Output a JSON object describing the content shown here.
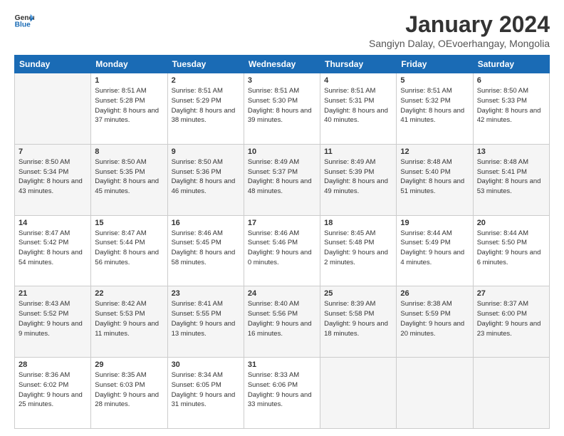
{
  "logo": {
    "line1": "General",
    "line2": "Blue"
  },
  "title": "January 2024",
  "location": "Sangiyn Dalay, OEvoerhangay, Mongolia",
  "days_of_week": [
    "Sunday",
    "Monday",
    "Tuesday",
    "Wednesday",
    "Thursday",
    "Friday",
    "Saturday"
  ],
  "weeks": [
    [
      {
        "day": "",
        "empty": true
      },
      {
        "day": "1",
        "sunrise": "8:51 AM",
        "sunset": "5:28 PM",
        "daylight": "8 hours and 37 minutes."
      },
      {
        "day": "2",
        "sunrise": "8:51 AM",
        "sunset": "5:29 PM",
        "daylight": "8 hours and 38 minutes."
      },
      {
        "day": "3",
        "sunrise": "8:51 AM",
        "sunset": "5:30 PM",
        "daylight": "8 hours and 39 minutes."
      },
      {
        "day": "4",
        "sunrise": "8:51 AM",
        "sunset": "5:31 PM",
        "daylight": "8 hours and 40 minutes."
      },
      {
        "day": "5",
        "sunrise": "8:51 AM",
        "sunset": "5:32 PM",
        "daylight": "8 hours and 41 minutes."
      },
      {
        "day": "6",
        "sunrise": "8:50 AM",
        "sunset": "5:33 PM",
        "daylight": "8 hours and 42 minutes."
      }
    ],
    [
      {
        "day": "7",
        "sunrise": "8:50 AM",
        "sunset": "5:34 PM",
        "daylight": "8 hours and 43 minutes."
      },
      {
        "day": "8",
        "sunrise": "8:50 AM",
        "sunset": "5:35 PM",
        "daylight": "8 hours and 45 minutes."
      },
      {
        "day": "9",
        "sunrise": "8:50 AM",
        "sunset": "5:36 PM",
        "daylight": "8 hours and 46 minutes."
      },
      {
        "day": "10",
        "sunrise": "8:49 AM",
        "sunset": "5:37 PM",
        "daylight": "8 hours and 48 minutes."
      },
      {
        "day": "11",
        "sunrise": "8:49 AM",
        "sunset": "5:39 PM",
        "daylight": "8 hours and 49 minutes."
      },
      {
        "day": "12",
        "sunrise": "8:48 AM",
        "sunset": "5:40 PM",
        "daylight": "8 hours and 51 minutes."
      },
      {
        "day": "13",
        "sunrise": "8:48 AM",
        "sunset": "5:41 PM",
        "daylight": "8 hours and 53 minutes."
      }
    ],
    [
      {
        "day": "14",
        "sunrise": "8:47 AM",
        "sunset": "5:42 PM",
        "daylight": "8 hours and 54 minutes."
      },
      {
        "day": "15",
        "sunrise": "8:47 AM",
        "sunset": "5:44 PM",
        "daylight": "8 hours and 56 minutes."
      },
      {
        "day": "16",
        "sunrise": "8:46 AM",
        "sunset": "5:45 PM",
        "daylight": "8 hours and 58 minutes."
      },
      {
        "day": "17",
        "sunrise": "8:46 AM",
        "sunset": "5:46 PM",
        "daylight": "9 hours and 0 minutes."
      },
      {
        "day": "18",
        "sunrise": "8:45 AM",
        "sunset": "5:48 PM",
        "daylight": "9 hours and 2 minutes."
      },
      {
        "day": "19",
        "sunrise": "8:44 AM",
        "sunset": "5:49 PM",
        "daylight": "9 hours and 4 minutes."
      },
      {
        "day": "20",
        "sunrise": "8:44 AM",
        "sunset": "5:50 PM",
        "daylight": "9 hours and 6 minutes."
      }
    ],
    [
      {
        "day": "21",
        "sunrise": "8:43 AM",
        "sunset": "5:52 PM",
        "daylight": "9 hours and 9 minutes."
      },
      {
        "day": "22",
        "sunrise": "8:42 AM",
        "sunset": "5:53 PM",
        "daylight": "9 hours and 11 minutes."
      },
      {
        "day": "23",
        "sunrise": "8:41 AM",
        "sunset": "5:55 PM",
        "daylight": "9 hours and 13 minutes."
      },
      {
        "day": "24",
        "sunrise": "8:40 AM",
        "sunset": "5:56 PM",
        "daylight": "9 hours and 16 minutes."
      },
      {
        "day": "25",
        "sunrise": "8:39 AM",
        "sunset": "5:58 PM",
        "daylight": "9 hours and 18 minutes."
      },
      {
        "day": "26",
        "sunrise": "8:38 AM",
        "sunset": "5:59 PM",
        "daylight": "9 hours and 20 minutes."
      },
      {
        "day": "27",
        "sunrise": "8:37 AM",
        "sunset": "6:00 PM",
        "daylight": "9 hours and 23 minutes."
      }
    ],
    [
      {
        "day": "28",
        "sunrise": "8:36 AM",
        "sunset": "6:02 PM",
        "daylight": "9 hours and 25 minutes."
      },
      {
        "day": "29",
        "sunrise": "8:35 AM",
        "sunset": "6:03 PM",
        "daylight": "9 hours and 28 minutes."
      },
      {
        "day": "30",
        "sunrise": "8:34 AM",
        "sunset": "6:05 PM",
        "daylight": "9 hours and 31 minutes."
      },
      {
        "day": "31",
        "sunrise": "8:33 AM",
        "sunset": "6:06 PM",
        "daylight": "9 hours and 33 minutes."
      },
      {
        "day": "",
        "empty": true
      },
      {
        "day": "",
        "empty": true
      },
      {
        "day": "",
        "empty": true
      }
    ]
  ],
  "labels": {
    "sunrise_prefix": "Sunrise: ",
    "sunset_prefix": "Sunset: ",
    "daylight_prefix": "Daylight: "
  }
}
